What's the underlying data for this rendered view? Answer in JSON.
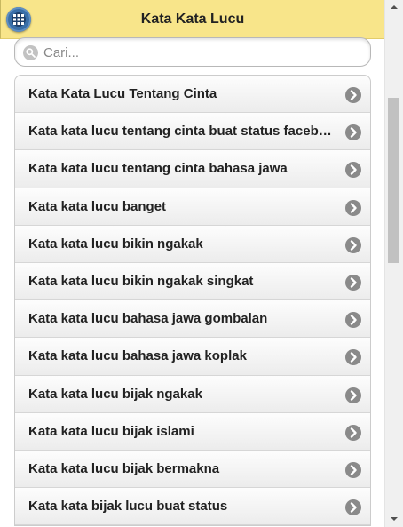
{
  "header": {
    "title": "Kata Kata Lucu",
    "menu_icon": "grid-menu-icon"
  },
  "search": {
    "placeholder": "Cari...",
    "value": "",
    "icon": "search-icon"
  },
  "list": {
    "items": [
      {
        "label": "Kata Kata Lucu Tentang Cinta"
      },
      {
        "label": "Kata kata lucu tentang cinta buat status facebook"
      },
      {
        "label": "Kata kata lucu tentang cinta bahasa jawa"
      },
      {
        "label": "Kata kata lucu banget"
      },
      {
        "label": "Kata kata lucu bikin ngakak"
      },
      {
        "label": "Kata kata lucu bikin ngakak singkat"
      },
      {
        "label": "Kata kata lucu bahasa jawa gombalan"
      },
      {
        "label": "Kata kata lucu bahasa jawa koplak"
      },
      {
        "label": "Kata kata lucu bijak ngakak"
      },
      {
        "label": "Kata kata lucu bijak islami"
      },
      {
        "label": "Kata kata lucu bijak bermakna"
      },
      {
        "label": "Kata kata bijak lucu buat status"
      }
    ],
    "chevron_icon": "chevron-right-icon"
  },
  "colors": {
    "header_bg": "#f8e58a",
    "menu_button": "#3a6fa8",
    "chevron_bg": "#8a8a8a"
  }
}
